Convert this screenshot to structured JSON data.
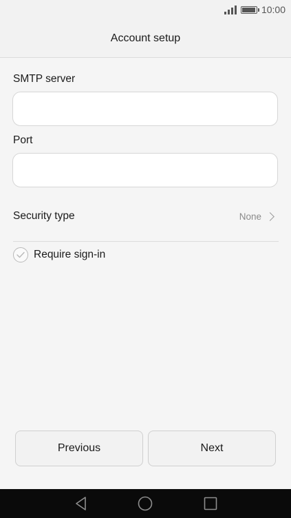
{
  "status_bar": {
    "time": "10:00",
    "icons": [
      "signal-icon",
      "battery-icon"
    ],
    "battery_level": 1.0
  },
  "header": {
    "title": "Account setup"
  },
  "form": {
    "smtp_server": {
      "label": "SMTP server",
      "value": "",
      "placeholder": ""
    },
    "port": {
      "label": "Port",
      "value": "",
      "placeholder": ""
    },
    "security_type": {
      "label": "Security type",
      "value": "None"
    },
    "require_sign_in": {
      "label": "Require sign-in",
      "checked": false
    }
  },
  "buttons": {
    "previous": "Previous",
    "next": "Next"
  },
  "nav_bar": {
    "icons": [
      "back-icon",
      "home-icon",
      "recents-icon"
    ]
  },
  "colors": {
    "background": "#f5f5f5",
    "header_background": "#f2f2f2",
    "nav_bar": "#0a0a0a",
    "text_primary": "#1a1a1a",
    "text_secondary": "#8a8a8a"
  }
}
